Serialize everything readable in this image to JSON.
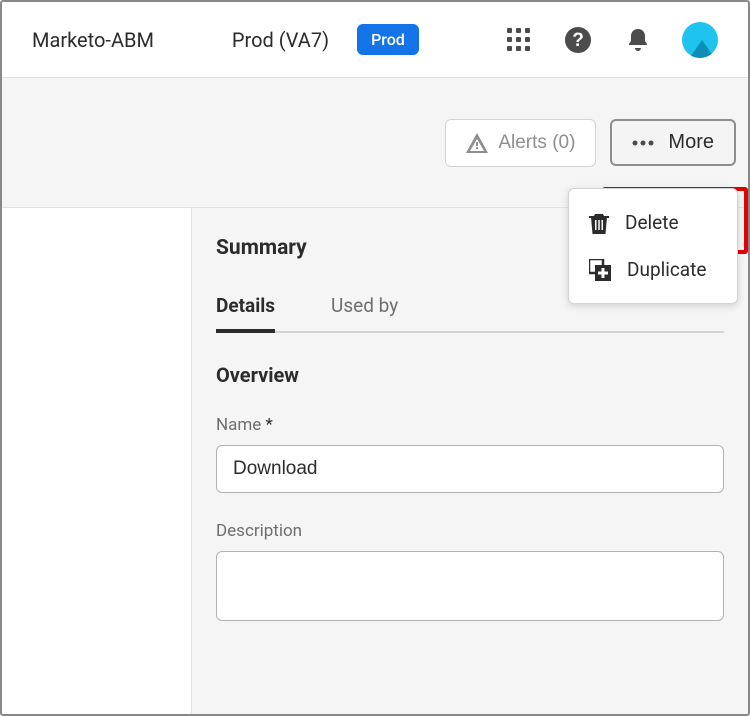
{
  "header": {
    "app_title": "Marketo-ABM",
    "env_label": "Prod (VA7)",
    "badge": "Prod"
  },
  "actions": {
    "alerts_label": "Alerts (0)",
    "more_label": "More",
    "menu": {
      "delete": "Delete",
      "duplicate": "Duplicate"
    }
  },
  "main": {
    "summary_title": "Summary",
    "tabs": {
      "details": "Details",
      "used_by": "Used by"
    },
    "overview": {
      "title": "Overview",
      "name_label": "Name",
      "name_required": "*",
      "name_value": "Download",
      "description_label": "Description",
      "description_value": ""
    }
  }
}
